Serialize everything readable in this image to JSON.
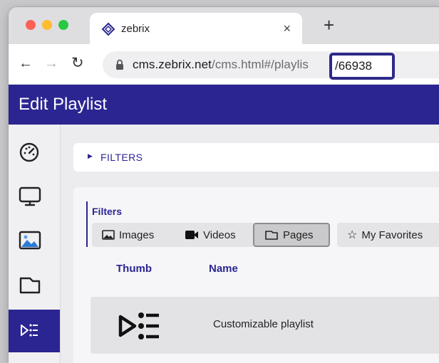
{
  "browser": {
    "tab_title": "zebrix",
    "tab_close": "×",
    "new_tab": "+",
    "url_host": "cms.zebrix.net",
    "url_path": "/cms.html#/playlis",
    "url_id": "/66938"
  },
  "app": {
    "title": "Edit Playlist"
  },
  "sidebar": {
    "items": [
      {
        "icon": "dashboard-gauge-icon",
        "active": false
      },
      {
        "icon": "monitor-icon",
        "active": false
      },
      {
        "icon": "image-icon",
        "active": false
      },
      {
        "icon": "page-icon",
        "active": false
      },
      {
        "icon": "playlist-icon",
        "active": true
      }
    ]
  },
  "filters_bar": {
    "label": "FILTERS"
  },
  "filters_panel": {
    "label": "Filters",
    "chips": [
      {
        "label": "Images",
        "icon": "image-icon",
        "selected": false
      },
      {
        "label": "Videos",
        "icon": "video-camera-icon",
        "selected": false
      },
      {
        "label": "Pages",
        "icon": "page-icon",
        "selected": true
      },
      {
        "label": "My Favorites",
        "icon": "star-icon",
        "selected": false
      }
    ]
  },
  "table": {
    "columns": [
      "Thumb",
      "Name"
    ],
    "rows": [
      {
        "thumb_icon": "playlist-icon",
        "name": "Customizable playlist"
      }
    ]
  },
  "colors": {
    "brand": "#2b2592",
    "highlight_border": "#2d2a8a"
  }
}
